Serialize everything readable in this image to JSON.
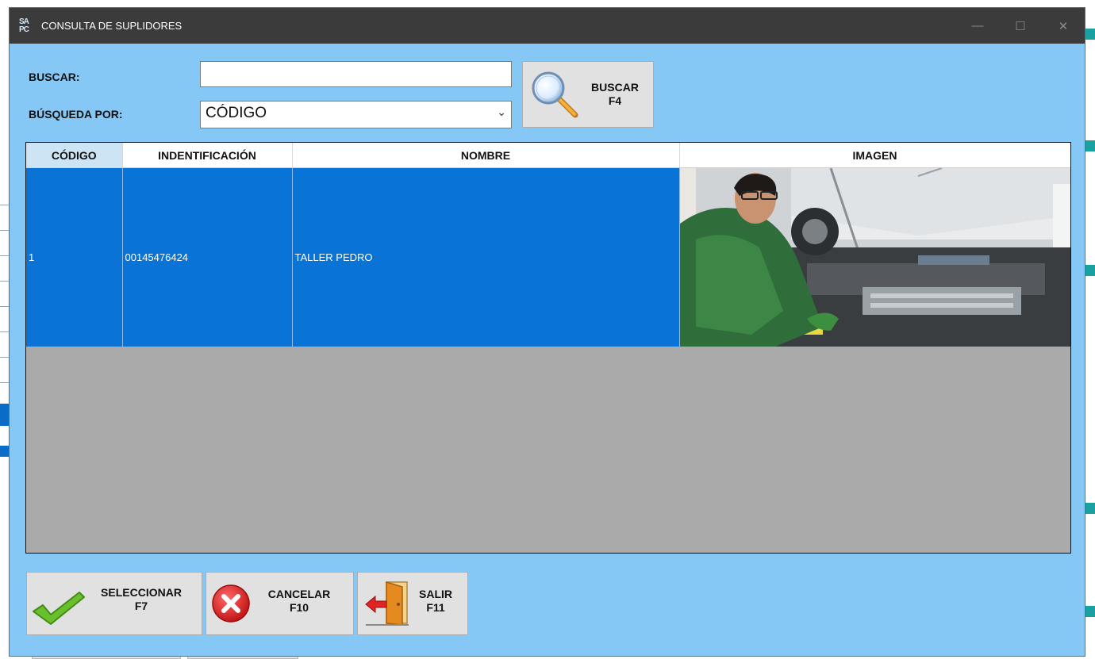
{
  "window": {
    "app_icon": "SA PC",
    "title": "CONSULTA DE SUPLIDORES",
    "minimize_icon": "minimize-icon",
    "maximize_icon": "maximize-icon",
    "close_icon": "close-icon"
  },
  "search": {
    "label": "BUSCAR:",
    "value": "",
    "placeholder": ""
  },
  "filter": {
    "label": "BÚSQUEDA POR:",
    "selected": "CÓDIGO"
  },
  "buttons": {
    "search_line1": "BUSCAR",
    "search_line2": "F4",
    "select_line1": "SELECCIONAR",
    "select_line2": "F7",
    "cancel_line1": "CANCELAR",
    "cancel_line2": "F10",
    "exit_line1": "SALIR",
    "exit_line2": "F11"
  },
  "table": {
    "columns": [
      "CÓDIGO",
      "INDENTIFICACIÓN",
      "NOMBRE",
      "IMAGEN"
    ],
    "rows": [
      {
        "codigo": "1",
        "identificacion": "00145476424",
        "nombre": "TALLER PEDRO",
        "imagen": "mechanic-photo"
      }
    ]
  },
  "colors": {
    "dialog_bg": "#85c8f5",
    "titlebar": "#3b3b3b",
    "selection": "#0a74d6",
    "grid_empty": "#aaaaaa"
  }
}
